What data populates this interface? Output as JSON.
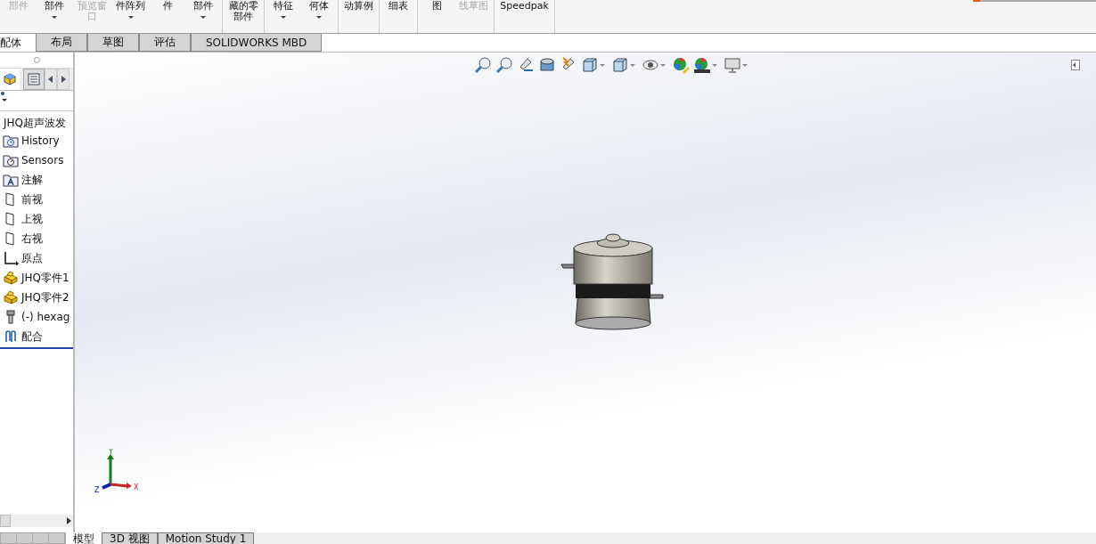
{
  "ribbon": {
    "groups": [
      [
        {
          "label": "部件",
          "disabled": true,
          "dropdown": false
        },
        {
          "label": "部件",
          "disabled": false,
          "dropdown": true
        },
        {
          "label": "预览窗口",
          "disabled": true,
          "dropdown": false
        },
        {
          "label": "件阵列",
          "disabled": false,
          "dropdown": true
        },
        {
          "label": "件",
          "disabled": false,
          "dropdown": false
        },
        {
          "label": "部件",
          "disabled": false,
          "dropdown": true
        }
      ],
      [
        {
          "label": "藏的零部件",
          "disabled": false,
          "dropdown": false
        }
      ],
      [
        {
          "label": "特征",
          "disabled": false,
          "dropdown": true
        },
        {
          "label": "何体",
          "disabled": false,
          "dropdown": true
        }
      ],
      [
        {
          "label": "动算例",
          "disabled": false,
          "dropdown": false
        }
      ],
      [
        {
          "label": "细表",
          "disabled": false,
          "dropdown": false
        }
      ],
      [
        {
          "label": "图",
          "disabled": false,
          "dropdown": false
        },
        {
          "label": "线草图",
          "disabled": true,
          "dropdown": false
        }
      ],
      [
        {
          "label": "Speedpak",
          "disabled": false,
          "dropdown": false
        }
      ]
    ]
  },
  "tabs": [
    {
      "label": "配体",
      "selected": true
    },
    {
      "label": "布局",
      "selected": false
    },
    {
      "label": "草图",
      "selected": false
    },
    {
      "label": "评估",
      "selected": false
    },
    {
      "label": "SOLIDWORKS MBD",
      "selected": false
    }
  ],
  "view_toolbar": [
    {
      "kind": "zoom-fit",
      "dropdown": false
    },
    {
      "kind": "zoom-area",
      "dropdown": false
    },
    {
      "kind": "previous",
      "dropdown": false
    },
    {
      "kind": "section",
      "dropdown": false
    },
    {
      "kind": "dynamic",
      "dropdown": false
    },
    {
      "kind": "orientation",
      "dropdown": true
    },
    {
      "kind": "display",
      "dropdown": true
    },
    {
      "kind": "hide",
      "dropdown": true
    },
    {
      "kind": "appearance",
      "dropdown": false
    },
    {
      "kind": "scene",
      "dropdown": true
    },
    {
      "kind": "monitor",
      "dropdown": true
    }
  ],
  "triad": {
    "y": "Y",
    "x": "X",
    "z": "Z"
  },
  "tree": {
    "root": "JHQ超声波发",
    "items": [
      {
        "kind": "history",
        "label": "History"
      },
      {
        "kind": "sensors",
        "label": "Sensors"
      },
      {
        "kind": "annotation",
        "label": "注解"
      },
      {
        "kind": "plane",
        "label": "前视"
      },
      {
        "kind": "plane",
        "label": "上视"
      },
      {
        "kind": "plane",
        "label": "右视"
      },
      {
        "kind": "origin",
        "label": "原点"
      },
      {
        "kind": "part",
        "label": "JHQ零件1"
      },
      {
        "kind": "part",
        "label": "JHQ零件2"
      },
      {
        "kind": "screw",
        "label": "(-) hexag"
      },
      {
        "kind": "mates",
        "label": "配合"
      }
    ]
  },
  "bottom_tabs": [
    {
      "label": "模型",
      "selected": true
    },
    {
      "label": "3D 视图",
      "selected": false
    },
    {
      "label": "Motion Study 1",
      "selected": false
    }
  ]
}
